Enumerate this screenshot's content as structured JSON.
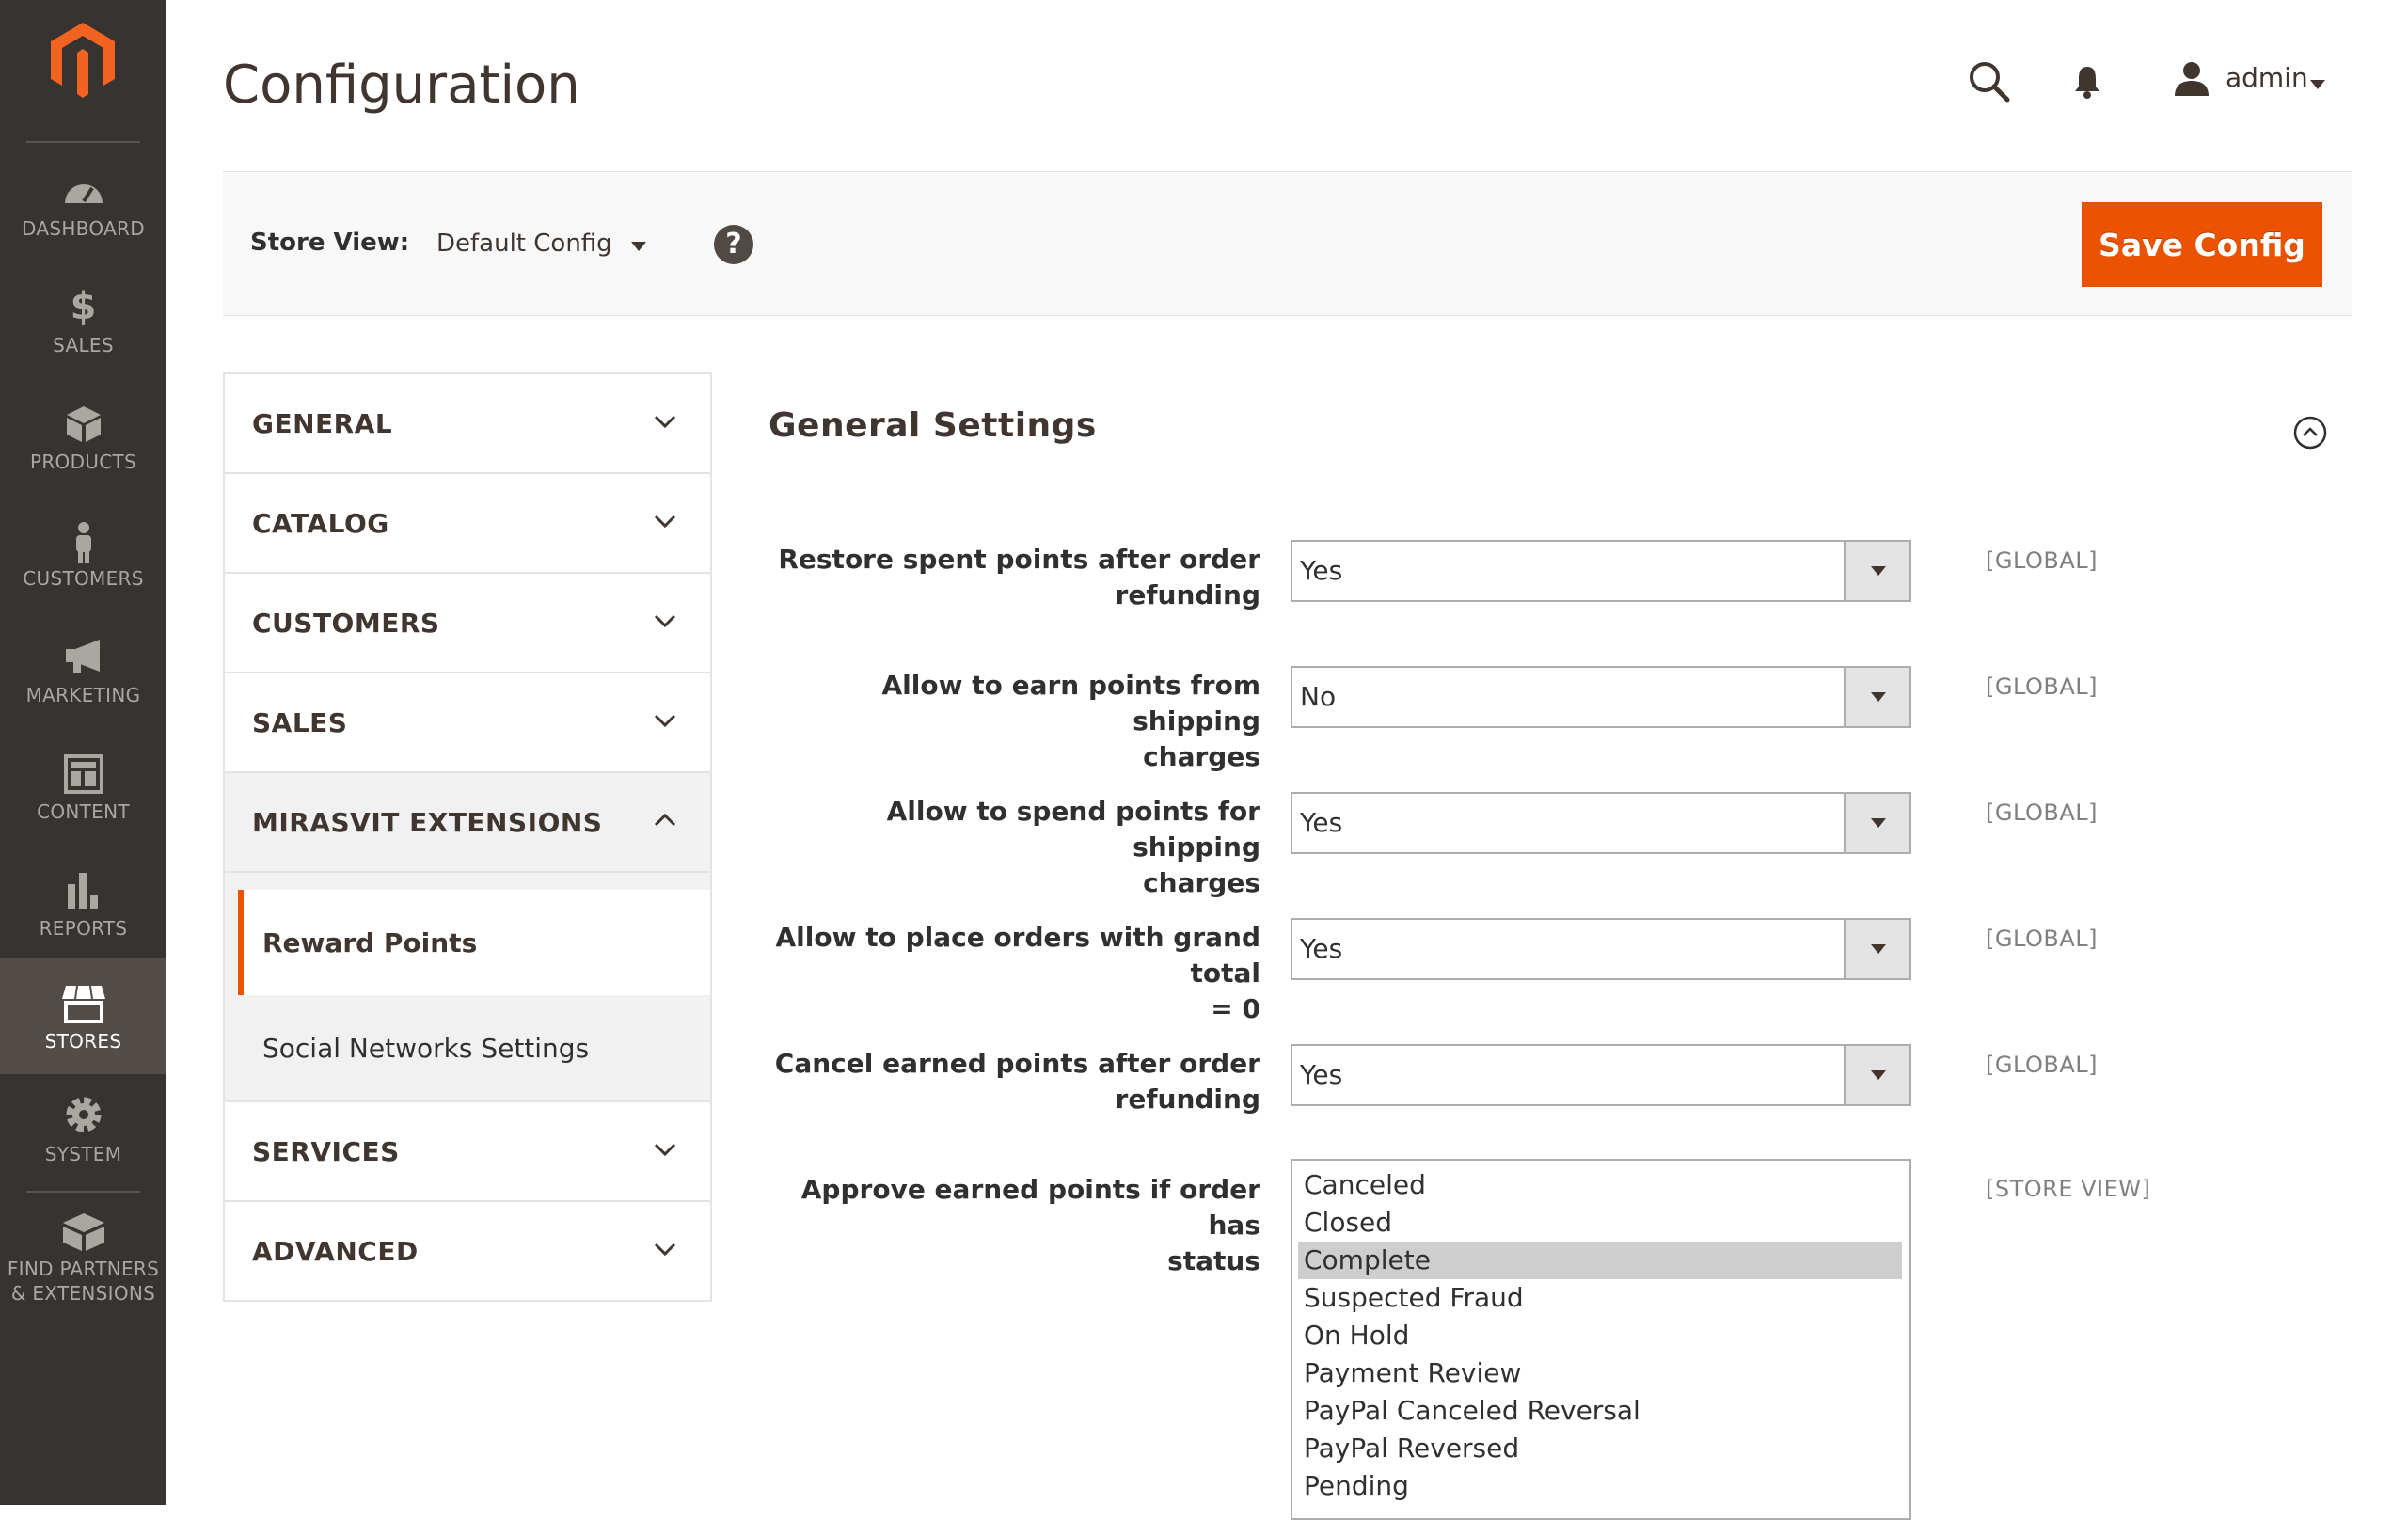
{
  "app": {
    "title": "Configuration",
    "admin_user": "admin"
  },
  "sidebar": {
    "logo": "magento-logo-icon",
    "items": [
      {
        "label": "DASHBOARD",
        "icon": "dashboard-icon"
      },
      {
        "label": "SALES",
        "icon": "dollar-icon"
      },
      {
        "label": "PRODUCTS",
        "icon": "box-icon"
      },
      {
        "label": "CUSTOMERS",
        "icon": "person-icon"
      },
      {
        "label": "MARKETING",
        "icon": "megaphone-icon"
      },
      {
        "label": "CONTENT",
        "icon": "layout-icon"
      },
      {
        "label": "REPORTS",
        "icon": "bar-chart-icon"
      },
      {
        "label": "STORES",
        "icon": "store-icon",
        "active": true
      },
      {
        "label": "SYSTEM",
        "icon": "gear-icon"
      },
      {
        "label_line1": "FIND PARTNERS",
        "label_line2": "& EXTENSIONS",
        "icon": "blocks-icon"
      }
    ]
  },
  "store_bar": {
    "label": "Store View:",
    "value": "Default Config",
    "help": "?",
    "save_label": "Save Config"
  },
  "tabs": {
    "general": "GENERAL",
    "catalog": "CATALOG",
    "customers": "CUSTOMERS",
    "sales": "SALES",
    "mirasvit": "MIRASVIT EXTENSIONS",
    "mirasvit_items": [
      "Reward Points",
      "Social Networks Settings"
    ],
    "services": "SERVICES",
    "advanced": "ADVANCED"
  },
  "section": {
    "title": "General Settings",
    "fields": [
      {
        "label_1": "Restore spent points after order",
        "label_2": "refunding",
        "value": "Yes",
        "scope": "[GLOBAL]"
      },
      {
        "label_1": "Allow to earn points from shipping",
        "label_2": "charges",
        "value": "No",
        "scope": "[GLOBAL]"
      },
      {
        "label_1": "Allow to spend points for shipping",
        "label_2": "charges",
        "value": "Yes",
        "scope": "[GLOBAL]"
      },
      {
        "label_1": "Allow to place orders with grand total",
        "label_2": "= 0",
        "value": "Yes",
        "scope": "[GLOBAL]"
      },
      {
        "label_1": "Cancel earned points after order",
        "label_2": "refunding",
        "value": "Yes",
        "scope": "[GLOBAL]"
      }
    ],
    "status_field": {
      "label_1": "Approve earned points if order has",
      "label_2": "status",
      "scope": "[STORE VIEW]",
      "options": [
        "Canceled",
        "Closed",
        "Complete",
        "Suspected Fraud",
        "On Hold",
        "Payment Review",
        "PayPal Canceled Reversal",
        "PayPal Reversed",
        "Pending"
      ],
      "selected": "Complete"
    }
  },
  "colors": {
    "accent": "#eb5202",
    "sidebar_bg": "#373330",
    "sidebar_active": "#524d49"
  }
}
